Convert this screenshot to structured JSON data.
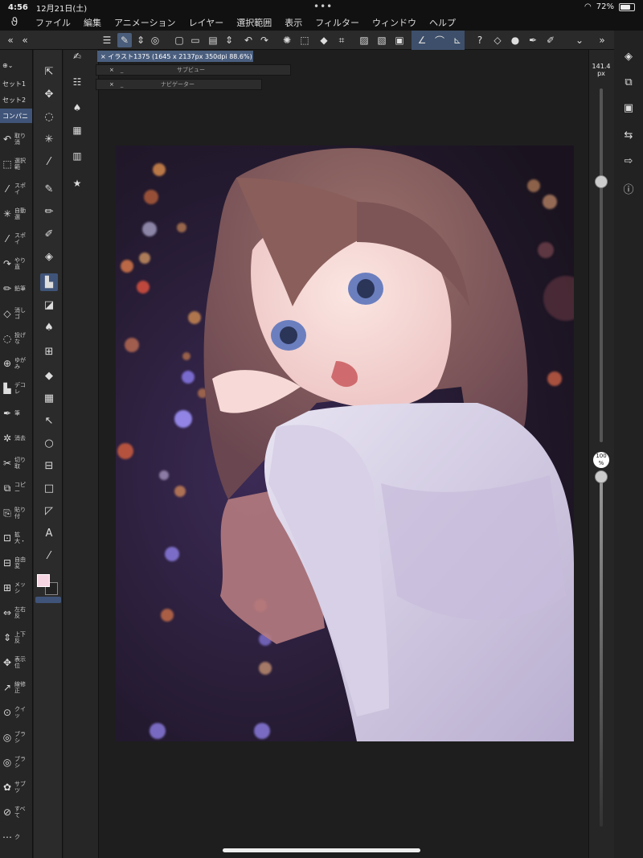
{
  "status": {
    "time": "4:56",
    "date": "12月21日(土)",
    "battery": "72%",
    "battery_level": 0.72
  },
  "menu": [
    "ファイル",
    "編集",
    "アニメーション",
    "レイヤー",
    "選択範囲",
    "表示",
    "フィルター",
    "ウィンドウ",
    "ヘルプ"
  ],
  "sets": [
    "セット1",
    "セット2",
    "コンパニ"
  ],
  "subtools": [
    {
      "icon": "undo-icon",
      "label": "取り消"
    },
    {
      "icon": "select-icon",
      "label": "選択範"
    },
    {
      "icon": "eyedropper-icon",
      "label": "スポイ"
    },
    {
      "icon": "auto-select-icon",
      "label": "自動選"
    },
    {
      "icon": "eyedropper-icon",
      "label": "スポイ"
    },
    {
      "icon": "redo-icon",
      "label": "やり直"
    },
    {
      "icon": "pencil-icon",
      "label": "鉛筆"
    },
    {
      "icon": "eraser-icon",
      "label": "消しゴ"
    },
    {
      "icon": "lasso-fill-icon",
      "label": "投げな"
    },
    {
      "icon": "warp-icon",
      "label": "ゆがみ"
    },
    {
      "icon": "deco-icon",
      "label": "デコレ"
    },
    {
      "icon": "pen-icon",
      "label": "筆"
    },
    {
      "icon": "erase-icon",
      "label": "消去"
    },
    {
      "icon": "scissors-icon",
      "label": "切り取"
    },
    {
      "icon": "copy-icon",
      "label": "コピー"
    },
    {
      "icon": "paste-icon",
      "label": "貼り付"
    },
    {
      "icon": "scale-icon",
      "label": "拡大・"
    },
    {
      "icon": "free-transform-icon",
      "label": "自由変"
    },
    {
      "icon": "mesh-icon",
      "label": "メッシ"
    },
    {
      "icon": "flip-h-icon",
      "label": "左右反"
    },
    {
      "icon": "flip-v-icon",
      "label": "上下反"
    },
    {
      "icon": "move-display-icon",
      "label": "表示位"
    },
    {
      "icon": "line-fix-icon",
      "label": "線修正"
    },
    {
      "icon": "quick-icon",
      "label": "クイッ"
    },
    {
      "icon": "brush-icon",
      "label": "ブラシ"
    },
    {
      "icon": "brush-icon",
      "label": "ブラシ"
    },
    {
      "icon": "subview-icon",
      "label": "サブツ"
    },
    {
      "icon": "all-icon",
      "label": "すべて"
    },
    {
      "icon": "more-icon",
      "label": "ク"
    }
  ],
  "doc": {
    "tab_label": "イラスト1375 (1645 x 2137px 350dpi 88.6%)",
    "subview_label": "サブビュー",
    "navigator_label": "ナビゲーター"
  },
  "right": {
    "brush_size": "141.4",
    "brush_unit": "px",
    "opacity": "100",
    "opacity_unit": "%"
  }
}
